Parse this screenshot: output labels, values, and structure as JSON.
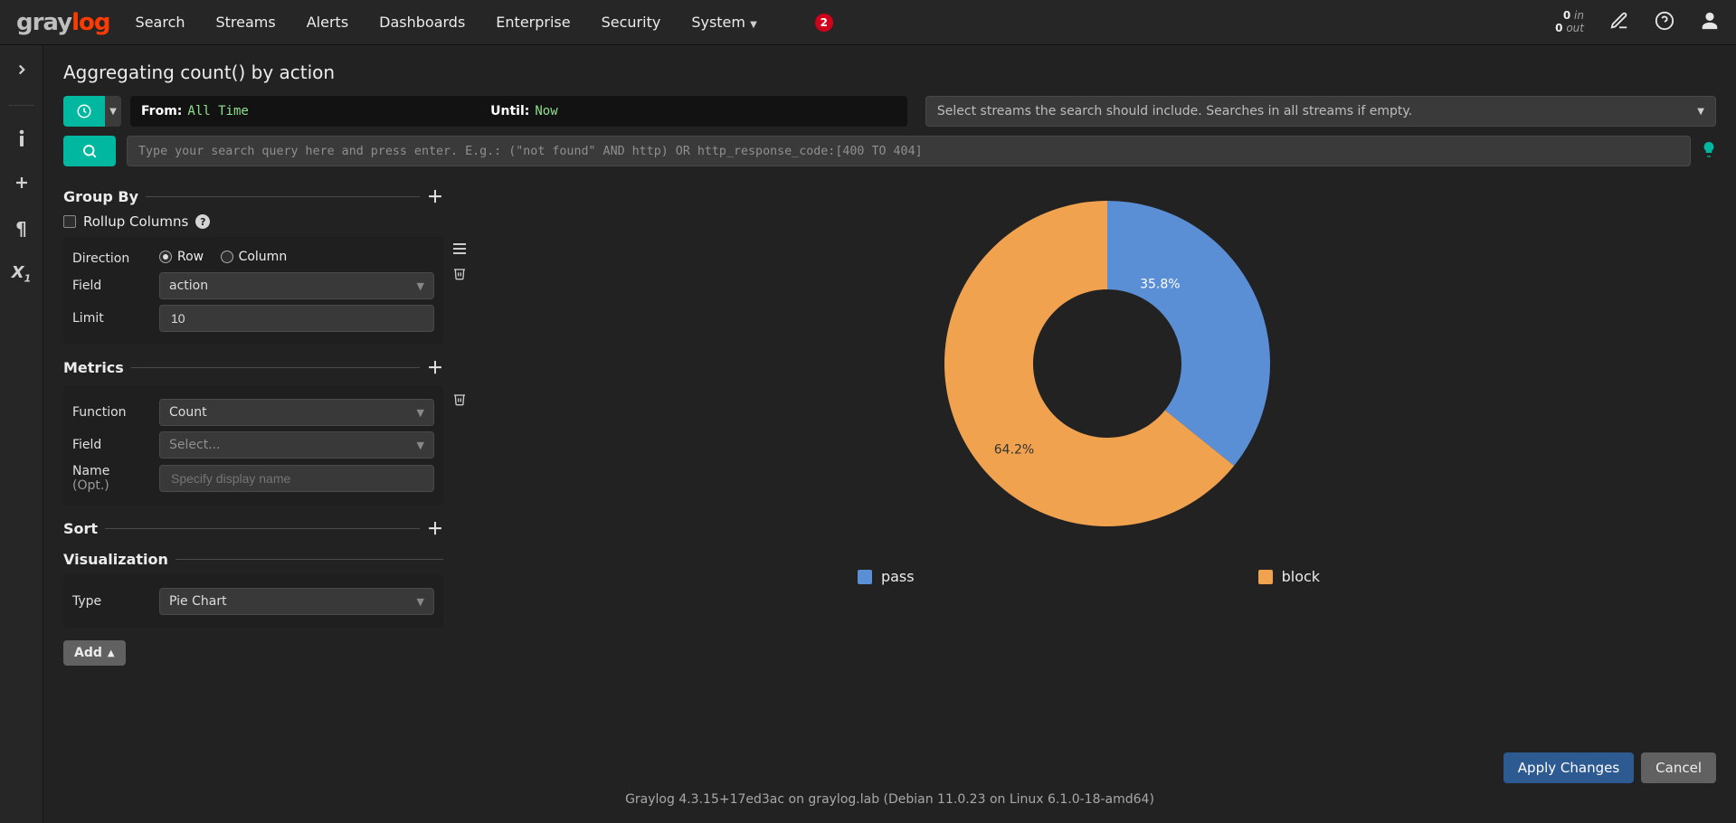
{
  "nav": {
    "links": [
      "Search",
      "Streams",
      "Alerts",
      "Dashboards",
      "Enterprise",
      "Security",
      "System"
    ],
    "notif_count": "2",
    "throughput": {
      "in_n": "0",
      "in_l": "in",
      "out_n": "0",
      "out_l": "out"
    }
  },
  "page": {
    "title": "Aggregating count() by action"
  },
  "timerange": {
    "from_k": "From:",
    "from_v": "All Time",
    "until_k": "Until:",
    "until_v": "Now"
  },
  "streams_placeholder": "Select streams the search should include. Searches in all streams if empty.",
  "query_placeholder": "Type your search query here and press enter. E.g.: (\"not found\" AND http) OR http_response_code:[400 TO 404]",
  "groupby": {
    "title": "Group By",
    "rollup": "Rollup Columns",
    "direction_label": "Direction",
    "row": "Row",
    "column": "Column",
    "field_label": "Field",
    "field_value": "action",
    "limit_label": "Limit",
    "limit_value": "10"
  },
  "metrics": {
    "title": "Metrics",
    "function_label": "Function",
    "function_value": "Count",
    "field_label": "Field",
    "field_placeholder": "Select...",
    "name_label": "Name",
    "name_opt": " (Opt.)",
    "name_placeholder": "Specify display name"
  },
  "sort": {
    "title": "Sort"
  },
  "viz": {
    "title": "Visualization",
    "type_label": "Type",
    "type_value": "Pie Chart"
  },
  "add_btn": "Add",
  "actions": {
    "apply": "Apply Changes",
    "cancel": "Cancel"
  },
  "footer": "Graylog 4.3.15+17ed3ac on graylog.lab (Debian 11.0.23 on Linux 6.1.0-18-amd64)",
  "chart_data": {
    "type": "pie",
    "title": "",
    "series": [
      {
        "name": "pass",
        "value": 35.8,
        "color": "#5a8fd6",
        "label": "35.8%"
      },
      {
        "name": "block",
        "value": 64.2,
        "color": "#f0a24f",
        "label": "64.2%"
      }
    ],
    "legend": [
      "pass",
      "block"
    ]
  }
}
